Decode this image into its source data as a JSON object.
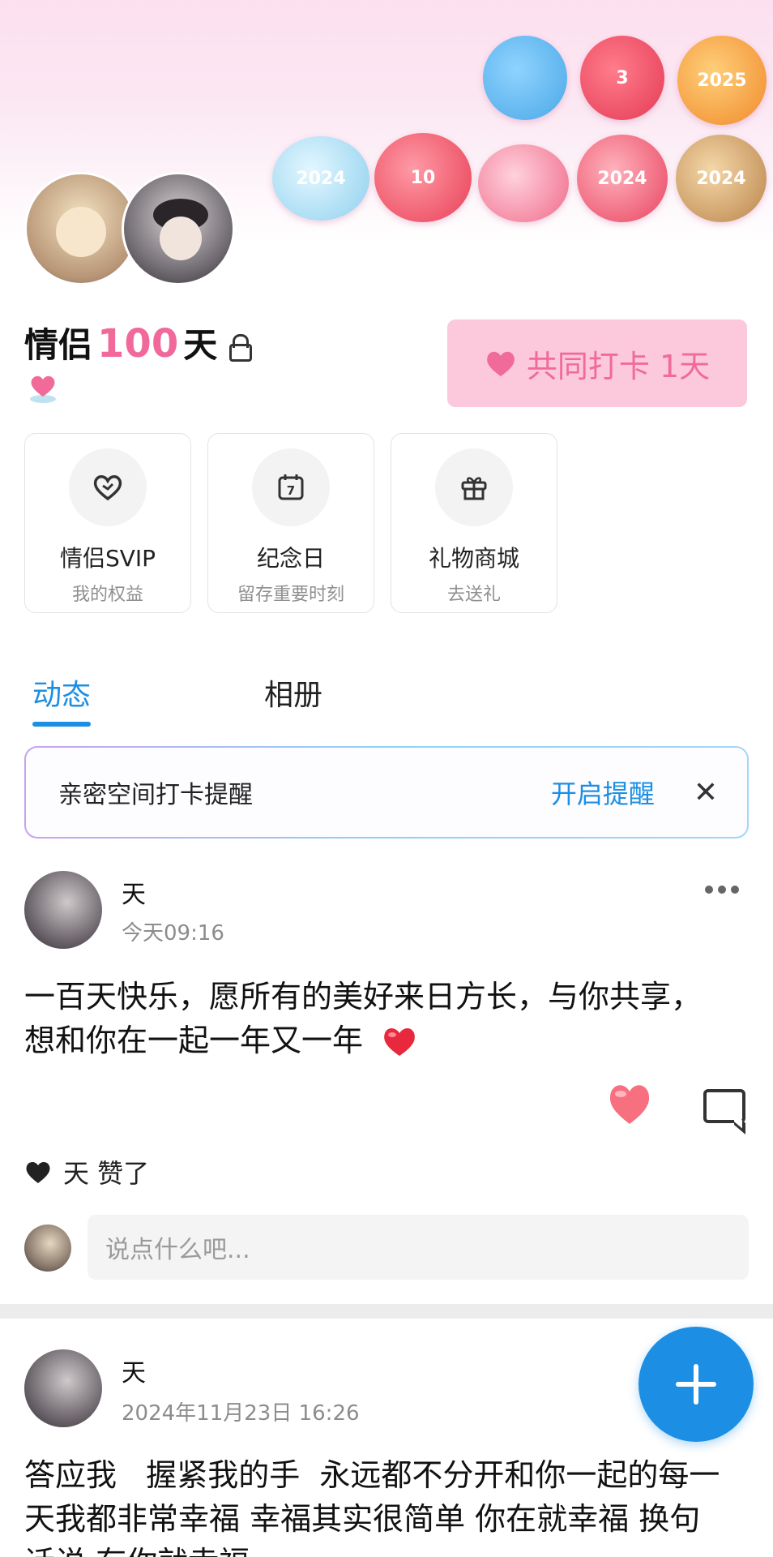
{
  "header": {
    "sticker_labels": [
      "",
      "3",
      "2025",
      "2024",
      "10",
      "",
      "2024",
      "2024"
    ]
  },
  "couple": {
    "days_prefix": "情侣",
    "days_number": "100",
    "days_suffix": "天",
    "checkin_label": "共同打卡 1天"
  },
  "features": [
    {
      "title": "情侣SVIP",
      "subtitle": "我的权益",
      "icon": "heart-outline-icon"
    },
    {
      "title": "纪念日",
      "subtitle": "留存重要时刻",
      "icon": "calendar-7-icon",
      "icon_text": "7"
    },
    {
      "title": "礼物商城",
      "subtitle": "去送礼",
      "icon": "gift-icon"
    }
  ],
  "tabs": [
    {
      "label": "动态",
      "active": true
    },
    {
      "label": "相册",
      "active": false
    }
  ],
  "reminder": {
    "text": "亲密空间打卡提醒",
    "action": "开启提醒",
    "close": "✕"
  },
  "posts": [
    {
      "author": "天",
      "time": "今天09:16",
      "content": "一百天快乐，愿所有的美好来日方长，与你共享，想和你在一起一年又一年",
      "liked_by": "天 赞了",
      "comment_placeholder": "说点什么吧..."
    },
    {
      "author": "天",
      "time": "2024年11月23日 16:26",
      "content": "答应我   握紧我的手  永远都不分开和你一起的每一天我都非常幸福 幸福其实很简单 你在就幸福 换句话说 有你就幸福"
    }
  ],
  "colors": {
    "accent": "#1c8fe4",
    "pink": "#f0699a",
    "checkin_bg": "#fbc8dc"
  }
}
